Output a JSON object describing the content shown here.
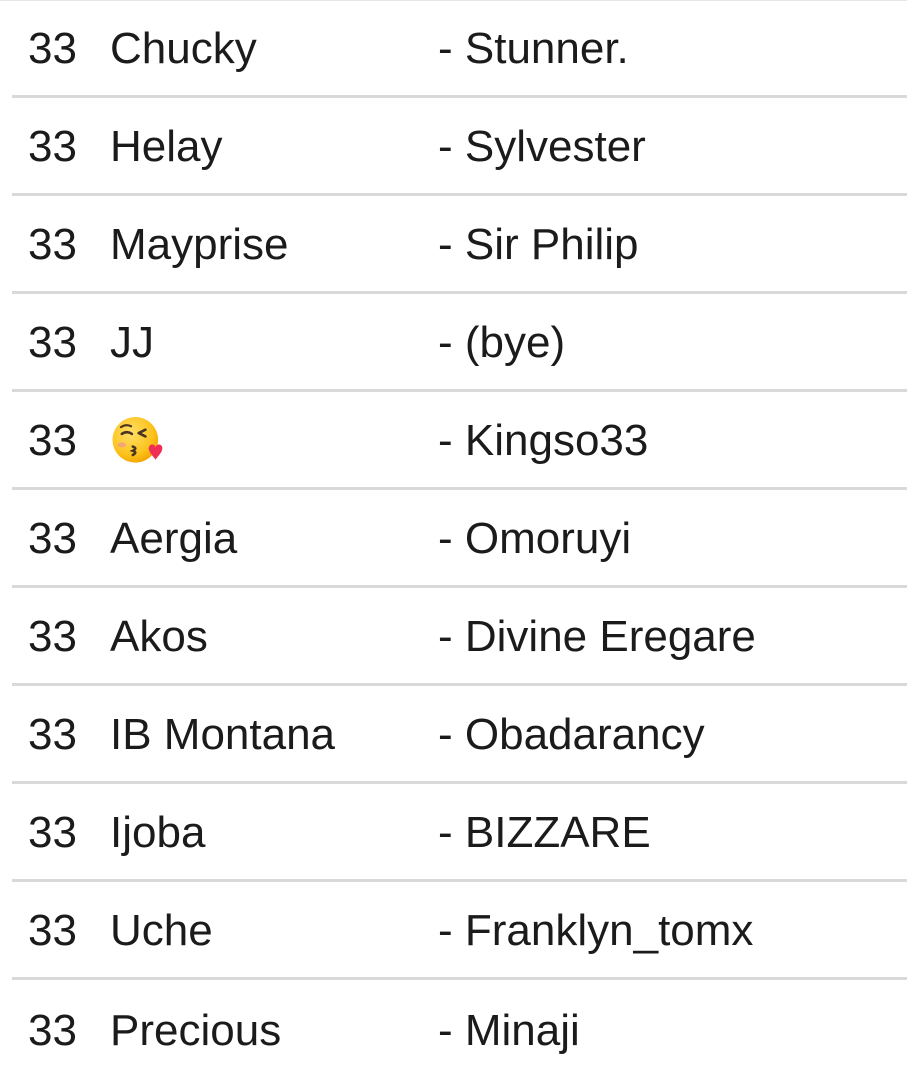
{
  "rows": [
    {
      "number": "33",
      "name": "Chucky",
      "partner": "- Stunner."
    },
    {
      "number": "33",
      "name": "Helay",
      "partner": "- Sylvester"
    },
    {
      "number": "33",
      "name": "Mayprise",
      "partner": "- Sir Philip"
    },
    {
      "number": "33",
      "name": "JJ",
      "partner": "- (bye)"
    },
    {
      "number": "33",
      "name": "",
      "name_icon": "face-blowing-kiss-emoji",
      "partner": "- Kingso33"
    },
    {
      "number": "33",
      "name": "Aergia",
      "partner": "- Omoruyi"
    },
    {
      "number": "33",
      "name": "Akos",
      "partner": "- Divine Eregare"
    },
    {
      "number": "33",
      "name": "IB Montana",
      "partner": "- Obadarancy"
    },
    {
      "number": "33",
      "name": "Ijoba",
      "partner": "- BIZZARE"
    },
    {
      "number": "33",
      "name": "Uche",
      "partner": "- Franklyn_tomx"
    },
    {
      "number": "33",
      "name": "Precious",
      "partner": "- Minaji"
    }
  ],
  "colors": {
    "text": "#1b1b1b",
    "divider": "#d9d9d9",
    "background": "#ffffff"
  }
}
